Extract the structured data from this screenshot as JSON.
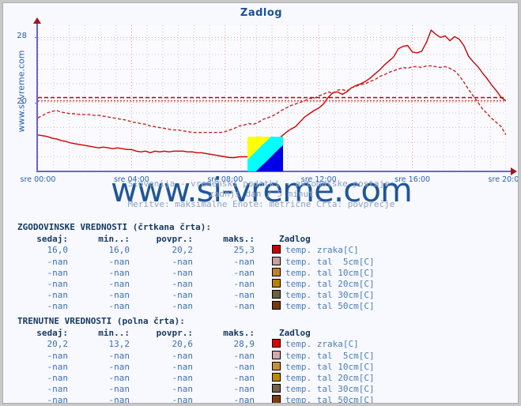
{
  "site": {
    "vertical_label": "www.si-vreme.com",
    "watermark": "www.si-vreme.com"
  },
  "chart": {
    "title": "Zadlog"
  },
  "subtitle": {
    "line1": "Slovenija - vremenski podatki - avtomatske postaje:",
    "line2": "zadnji dan / 5 minut",
    "line3": "Meritve: maksimalne  Enote: metrične  Črta: povprečje"
  },
  "chart_data": {
    "type": "line",
    "title": "Zadlog",
    "xlabel": "",
    "ylabel": "",
    "ylim": [
      11.5,
      29.5
    ],
    "yticks": [
      20,
      28
    ],
    "ytick_labels": [
      "20",
      "28"
    ],
    "xticks": [
      "sre 00:00",
      "sre 04:00",
      "sre 08:00",
      "sre 12:00",
      "sre 16:00",
      "sre 20:00"
    ],
    "xtick_positions": [
      0,
      0.2,
      0.4,
      0.6,
      0.8,
      1.0
    ],
    "grid": true,
    "legend_position": "below",
    "average_lines": [
      {
        "name": "povprečje trenutne",
        "value": 20.6,
        "color": "#cc0000",
        "style": "dashed"
      },
      {
        "name": "povprečje zgodovinske",
        "value": 20.2,
        "color": "#dd4444",
        "style": "dotted"
      }
    ],
    "series": [
      {
        "name": "temp. zraka [C] - trenutne (polna črta)",
        "style": "solid",
        "color": "#cc0000",
        "x": [
          0,
          0.01,
          0.02,
          0.03,
          0.04,
          0.05,
          0.06,
          0.07,
          0.08,
          0.09,
          0.1,
          0.11,
          0.12,
          0.13,
          0.14,
          0.15,
          0.16,
          0.17,
          0.18,
          0.19,
          0.2,
          0.21,
          0.22,
          0.23,
          0.24,
          0.25,
          0.26,
          0.27,
          0.28,
          0.29,
          0.3,
          0.31,
          0.32,
          0.33,
          0.34,
          0.35,
          0.36,
          0.37,
          0.38,
          0.39,
          0.4,
          0.41,
          0.42,
          0.43,
          0.44,
          0.45,
          0.46,
          0.47,
          0.48,
          0.49,
          0.5,
          0.51,
          0.52,
          0.53,
          0.54,
          0.55,
          0.56,
          0.57,
          0.58,
          0.59,
          0.6,
          0.61,
          0.62,
          0.63,
          0.64,
          0.65,
          0.66,
          0.67,
          0.68,
          0.69,
          0.7,
          0.71,
          0.72,
          0.73,
          0.74,
          0.75,
          0.76,
          0.77,
          0.78,
          0.79,
          0.8,
          0.81,
          0.82,
          0.83,
          0.84,
          0.85,
          0.86,
          0.87,
          0.88,
          0.89,
          0.9,
          0.91,
          0.92,
          0.93,
          0.94,
          0.95,
          0.96,
          0.97,
          0.98,
          0.99,
          1.0
        ],
        "values": [
          16.0,
          15.9,
          15.8,
          15.6,
          15.5,
          15.3,
          15.2,
          15.0,
          14.9,
          14.8,
          14.7,
          14.6,
          14.5,
          14.4,
          14.5,
          14.4,
          14.3,
          14.4,
          14.3,
          14.2,
          14.2,
          14.0,
          13.9,
          14.0,
          13.8,
          14.0,
          13.9,
          14.0,
          13.9,
          14.0,
          14.0,
          14.0,
          13.9,
          13.9,
          13.8,
          13.8,
          13.7,
          13.6,
          13.5,
          13.4,
          13.3,
          13.2,
          13.2,
          13.3,
          13.3,
          13.3,
          13.5,
          14.2,
          14.6,
          15.0,
          15.2,
          15.4,
          15.8,
          16.3,
          16.7,
          17.0,
          17.6,
          18.2,
          18.6,
          19.0,
          19.3,
          19.8,
          20.6,
          21.2,
          21.3,
          21.0,
          21.3,
          21.8,
          22.1,
          22.3,
          22.6,
          23.0,
          23.5,
          24.0,
          24.6,
          25.1,
          25.6,
          26.6,
          26.9,
          27.0,
          26.2,
          26.1,
          26.3,
          27.4,
          28.9,
          28.4,
          28.0,
          28.2,
          27.6,
          28.1,
          27.8,
          27.0,
          25.7,
          25.0,
          24.4,
          23.6,
          22.9,
          22.1,
          21.4,
          20.6,
          20.2
        ]
      },
      {
        "name": "temp. zraka [C] - zgodovinske (črtkana črta)",
        "style": "dashed",
        "color": "#cc2222",
        "x": [
          0,
          0.01,
          0.02,
          0.03,
          0.04,
          0.05,
          0.06,
          0.07,
          0.08,
          0.09,
          0.1,
          0.11,
          0.12,
          0.13,
          0.14,
          0.15,
          0.16,
          0.17,
          0.18,
          0.19,
          0.2,
          0.21,
          0.22,
          0.23,
          0.24,
          0.25,
          0.26,
          0.27,
          0.28,
          0.29,
          0.3,
          0.31,
          0.32,
          0.33,
          0.34,
          0.35,
          0.36,
          0.37,
          0.38,
          0.39,
          0.4,
          0.41,
          0.42,
          0.43,
          0.44,
          0.45,
          0.46,
          0.47,
          0.48,
          0.49,
          0.5,
          0.51,
          0.52,
          0.53,
          0.54,
          0.55,
          0.56,
          0.57,
          0.58,
          0.59,
          0.6,
          0.61,
          0.62,
          0.63,
          0.64,
          0.65,
          0.66,
          0.67,
          0.68,
          0.69,
          0.7,
          0.71,
          0.72,
          0.73,
          0.74,
          0.75,
          0.76,
          0.77,
          0.78,
          0.79,
          0.8,
          0.81,
          0.82,
          0.83,
          0.84,
          0.85,
          0.86,
          0.87,
          0.88,
          0.89,
          0.9,
          0.91,
          0.92,
          0.93,
          0.94,
          0.95,
          0.96,
          0.97,
          0.98,
          0.99,
          1.0
        ],
        "values": [
          18.1,
          18.4,
          18.7,
          18.9,
          19.0,
          18.8,
          18.7,
          18.6,
          18.6,
          18.5,
          18.5,
          18.5,
          18.4,
          18.4,
          18.3,
          18.2,
          18.1,
          18.0,
          17.9,
          17.8,
          17.6,
          17.5,
          17.4,
          17.3,
          17.1,
          17.0,
          16.9,
          16.8,
          16.7,
          16.6,
          16.6,
          16.5,
          16.4,
          16.3,
          16.3,
          16.3,
          16.3,
          16.3,
          16.3,
          16.3,
          16.4,
          16.6,
          16.8,
          17.1,
          17.2,
          17.4,
          17.3,
          17.5,
          17.9,
          18.1,
          18.3,
          18.6,
          19.0,
          19.3,
          19.6,
          19.8,
          20.0,
          20.2,
          20.5,
          20.5,
          20.8,
          21.0,
          21.3,
          21.1,
          21.5,
          21.6,
          21.4,
          21.8,
          22.0,
          22.2,
          22.3,
          22.6,
          22.8,
          23.2,
          23.4,
          23.7,
          23.9,
          24.1,
          24.3,
          24.2,
          24.4,
          24.4,
          24.3,
          24.5,
          24.5,
          24.4,
          24.3,
          24.4,
          24.2,
          23.9,
          23.3,
          22.5,
          21.6,
          20.8,
          20.0,
          19.2,
          18.6,
          18.0,
          17.5,
          17.0,
          16.0
        ]
      }
    ]
  },
  "tables": [
    {
      "id": "hist",
      "heading": "ZGODOVINSKE VREDNOSTI (črtkana črta):",
      "columns": [
        "sedaj:",
        "min..:",
        "povpr.:",
        "maks.:"
      ],
      "station": "Zadlog",
      "rows": [
        {
          "sedaj": "16,0",
          "min": "16,0",
          "povpr": "20,2",
          "maks": "25,3",
          "color": "#cc0000",
          "label": "temp. zraka[C]"
        },
        {
          "sedaj": "-nan",
          "min": "-nan",
          "povpr": "-nan",
          "maks": "-nan",
          "color": "#c8a0a0",
          "label": "temp. tal  5cm[C]"
        },
        {
          "sedaj": "-nan",
          "min": "-nan",
          "povpr": "-nan",
          "maks": "-nan",
          "color": "#bf8030",
          "label": "temp. tal 10cm[C]"
        },
        {
          "sedaj": "-nan",
          "min": "-nan",
          "povpr": "-nan",
          "maks": "-nan",
          "color": "#bc8000",
          "label": "temp. tal 20cm[C]"
        },
        {
          "sedaj": "-nan",
          "min": "-nan",
          "povpr": "-nan",
          "maks": "-nan",
          "color": "#6b6046",
          "label": "temp. tal 30cm[C]"
        },
        {
          "sedaj": "-nan",
          "min": "-nan",
          "povpr": "-nan",
          "maks": "-nan",
          "color": "#7a3a0c",
          "label": "temp. tal 50cm[C]"
        }
      ]
    },
    {
      "id": "curr",
      "heading": "TRENUTNE VREDNOSTI (polna črta):",
      "columns": [
        "sedaj:",
        "min..:",
        "povpr.:",
        "maks.:"
      ],
      "station": "Zadlog",
      "rows": [
        {
          "sedaj": "20,2",
          "min": "13,2",
          "povpr": "20,6",
          "maks": "28,9",
          "color": "#e00000",
          "label": "temp. zraka[C]"
        },
        {
          "sedaj": "-nan",
          "min": "-nan",
          "povpr": "-nan",
          "maks": "-nan",
          "color": "#d2a8a8",
          "label": "temp. tal  5cm[C]"
        },
        {
          "sedaj": "-nan",
          "min": "-nan",
          "povpr": "-nan",
          "maks": "-nan",
          "color": "#c98f3c",
          "label": "temp. tal 10cm[C]"
        },
        {
          "sedaj": "-nan",
          "min": "-nan",
          "povpr": "-nan",
          "maks": "-nan",
          "color": "#c08800",
          "label": "temp. tal 20cm[C]"
        },
        {
          "sedaj": "-nan",
          "min": "-nan",
          "povpr": "-nan",
          "maks": "-nan",
          "color": "#706448",
          "label": "temp. tal 30cm[C]"
        },
        {
          "sedaj": "-nan",
          "min": "-nan",
          "povpr": "-nan",
          "maks": "-nan",
          "color": "#7c3d0e",
          "label": "temp. tal 50cm[C]"
        }
      ]
    }
  ]
}
